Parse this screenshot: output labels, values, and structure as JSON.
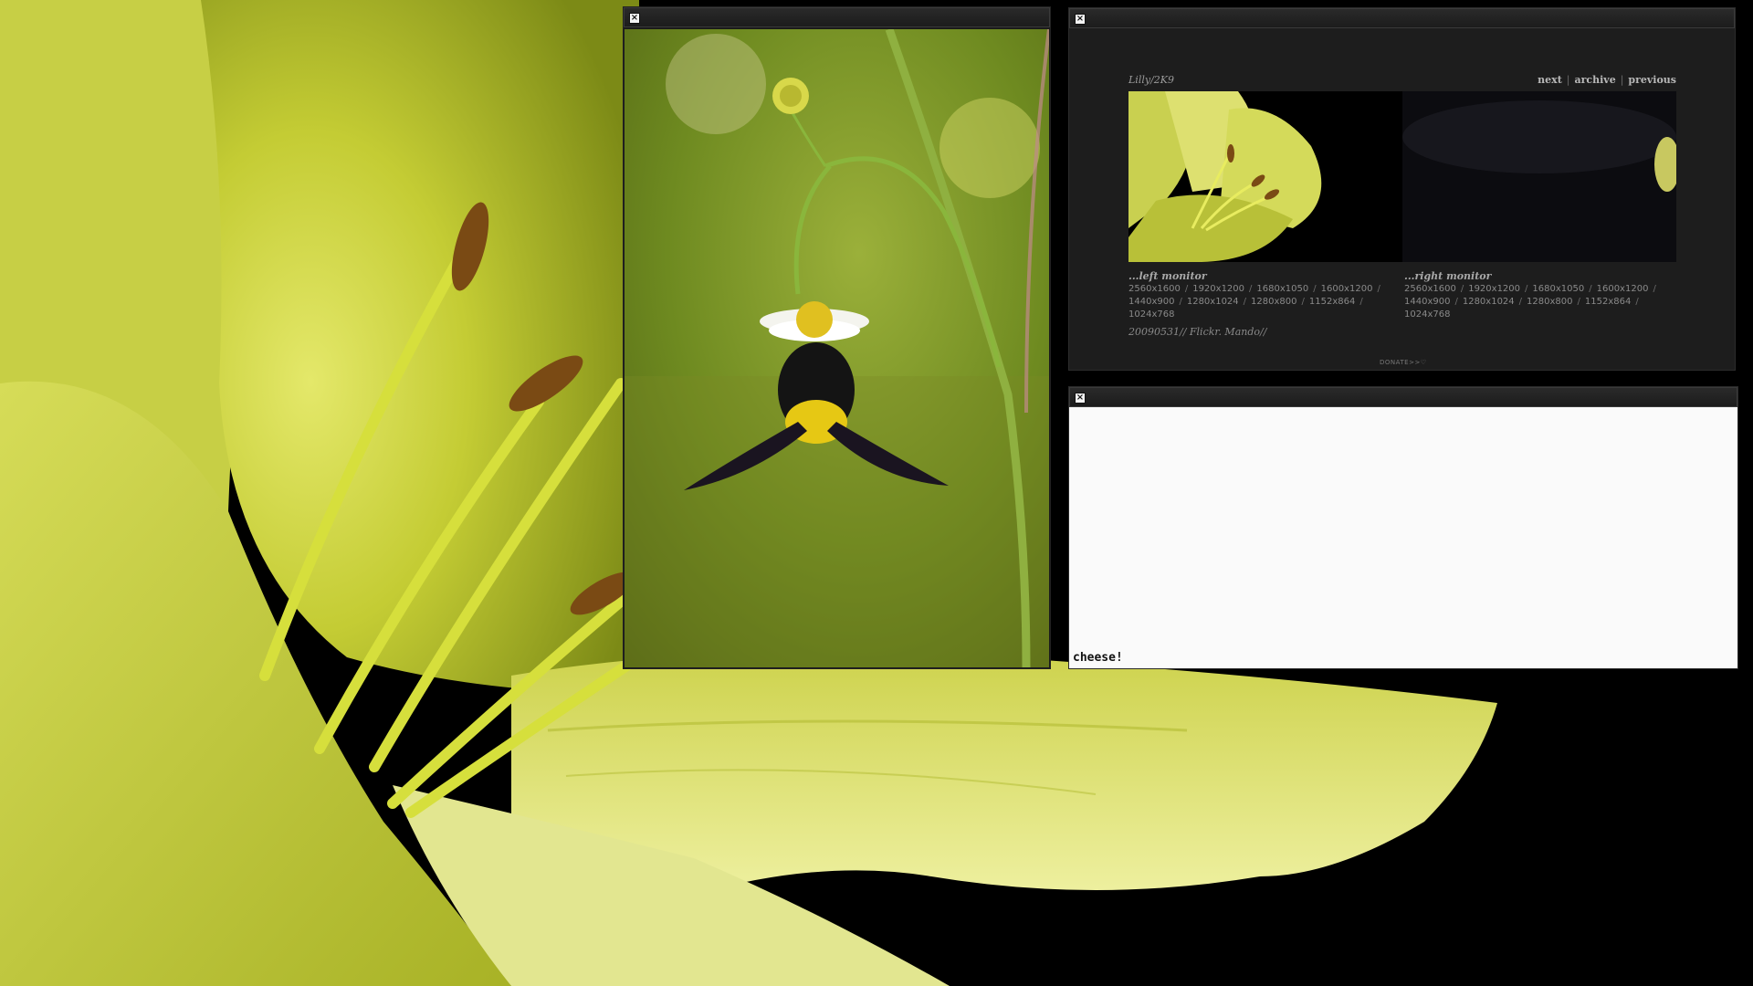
{
  "desktop": {
    "wallpaper": "yellow-lily-wallpaper"
  },
  "photo_window": {
    "close_label": "×",
    "image": "carpenter-bee-on-white-flower-photo"
  },
  "site_window": {
    "close_label": "×",
    "title": "Lilly/2K9",
    "nav": {
      "next": "next",
      "archive": "archive",
      "previous": "previous",
      "separator": "|"
    },
    "banner": "lily-banner-image",
    "left_monitor": {
      "heading": "...left monitor",
      "resolutions": [
        "2560x1600",
        "1920x1200",
        "1680x1050",
        "1600x1200",
        "1440x900",
        "1280x1024",
        "1280x800",
        "1152x864",
        "1024x768"
      ]
    },
    "right_monitor": {
      "heading": "...right monitor",
      "resolutions": [
        "2560x1600",
        "1920x1200",
        "1680x1050",
        "1600x1200",
        "1440x900",
        "1280x1024",
        "1280x800",
        "1152x864",
        "1024x768"
      ]
    },
    "credit": "20090531// Flickr. Mando//",
    "donate": "DONATE>>♡"
  },
  "terminal_window": {
    "close_label": "×",
    "text": "cheese!"
  },
  "colors": {
    "lily_yellow": "#c8d040",
    "window_dark": "#1c1c1c",
    "terminal_bg": "#fafafa"
  }
}
